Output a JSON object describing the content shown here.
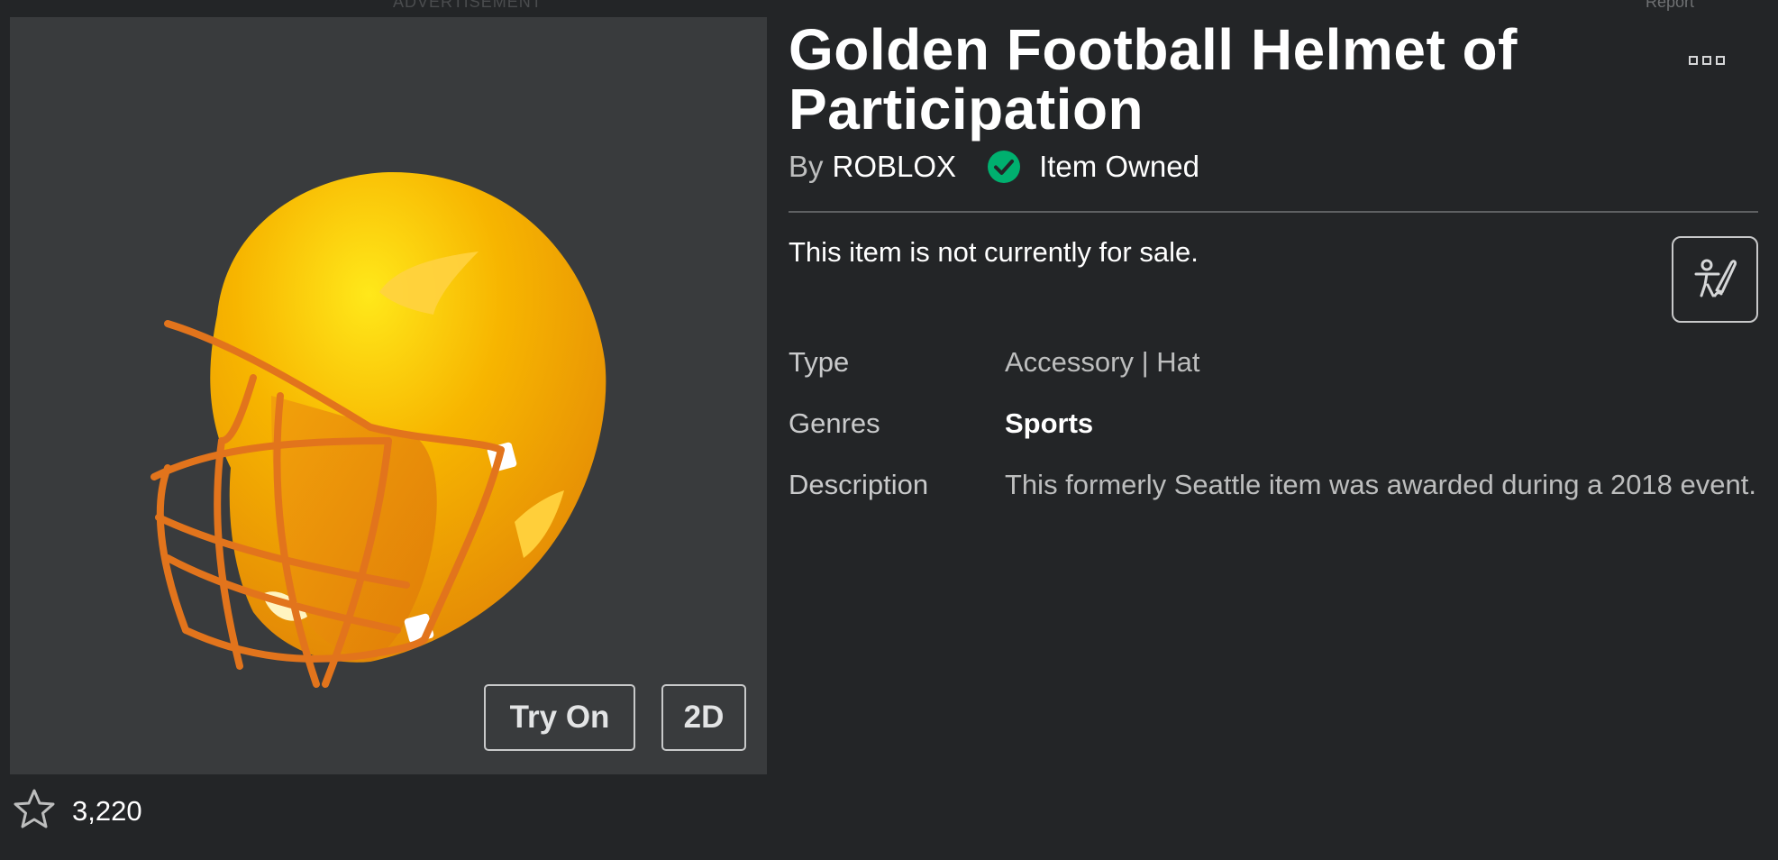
{
  "header": {
    "ad_label": "ADVERTISEMENT",
    "report_label": "Report"
  },
  "thumbnail": {
    "try_on_label": "Try On",
    "view_2d_label": "2D",
    "subject": "golden football helmet"
  },
  "favorites": {
    "icon": "star-outline-icon",
    "count": "3,220"
  },
  "item": {
    "title": "Golden Football Helmet of Participation",
    "by_prefix": "By",
    "creator": "ROBLOX",
    "owned_icon": "check-circle-icon",
    "owned_label": "Item Owned",
    "sale_status": "This item is not currently for sale.",
    "more_icon": "more-options-icon",
    "avatar_icon": "avatar-customize-icon"
  },
  "details": {
    "type_label": "Type",
    "type_value": "Accessory | Hat",
    "genres_label": "Genres",
    "genres_value": "Sports",
    "description_label": "Description",
    "description_value": "This formerly Seattle item was awarded during a 2018 event."
  },
  "colors": {
    "background": "#232527",
    "thumbnail_bg": "#393b3d",
    "owned_green": "#00b06f",
    "helmet_gold": "#f5b300",
    "facemask_orange": "#e0741a"
  }
}
